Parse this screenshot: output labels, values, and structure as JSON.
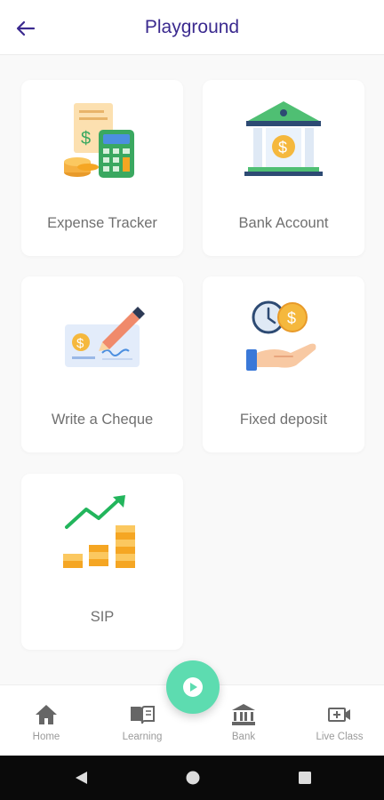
{
  "header": {
    "title": "Playground",
    "back_icon": "arrow-left-icon"
  },
  "cards": [
    {
      "label": "Expense Tracker",
      "icon": "calculator-receipt-icon"
    },
    {
      "label": "Bank Account",
      "icon": "bank-building-icon"
    },
    {
      "label": "Write a Cheque",
      "icon": "cheque-pen-icon"
    },
    {
      "label": "Fixed deposit",
      "icon": "clock-coin-hand-icon"
    },
    {
      "label": "SIP",
      "icon": "growth-chart-coins-icon"
    }
  ],
  "fab": {
    "icon": "play-icon"
  },
  "bottom_nav": [
    {
      "label": "Home",
      "icon": "home-icon"
    },
    {
      "label": "Learning",
      "icon": "book-icon"
    },
    {
      "label": "Bank",
      "icon": "bank-icon"
    },
    {
      "label": "Live Class",
      "icon": "video-plus-icon"
    }
  ],
  "system_bar": {
    "buttons": [
      "back-triangle-icon",
      "home-circle-icon",
      "recents-square-icon"
    ]
  },
  "colors": {
    "accent": "#3b2a8f",
    "fab": "#5ddcb0",
    "label": "#707070",
    "nav_label": "#9a9a9a",
    "background": "#f9f9f9"
  }
}
